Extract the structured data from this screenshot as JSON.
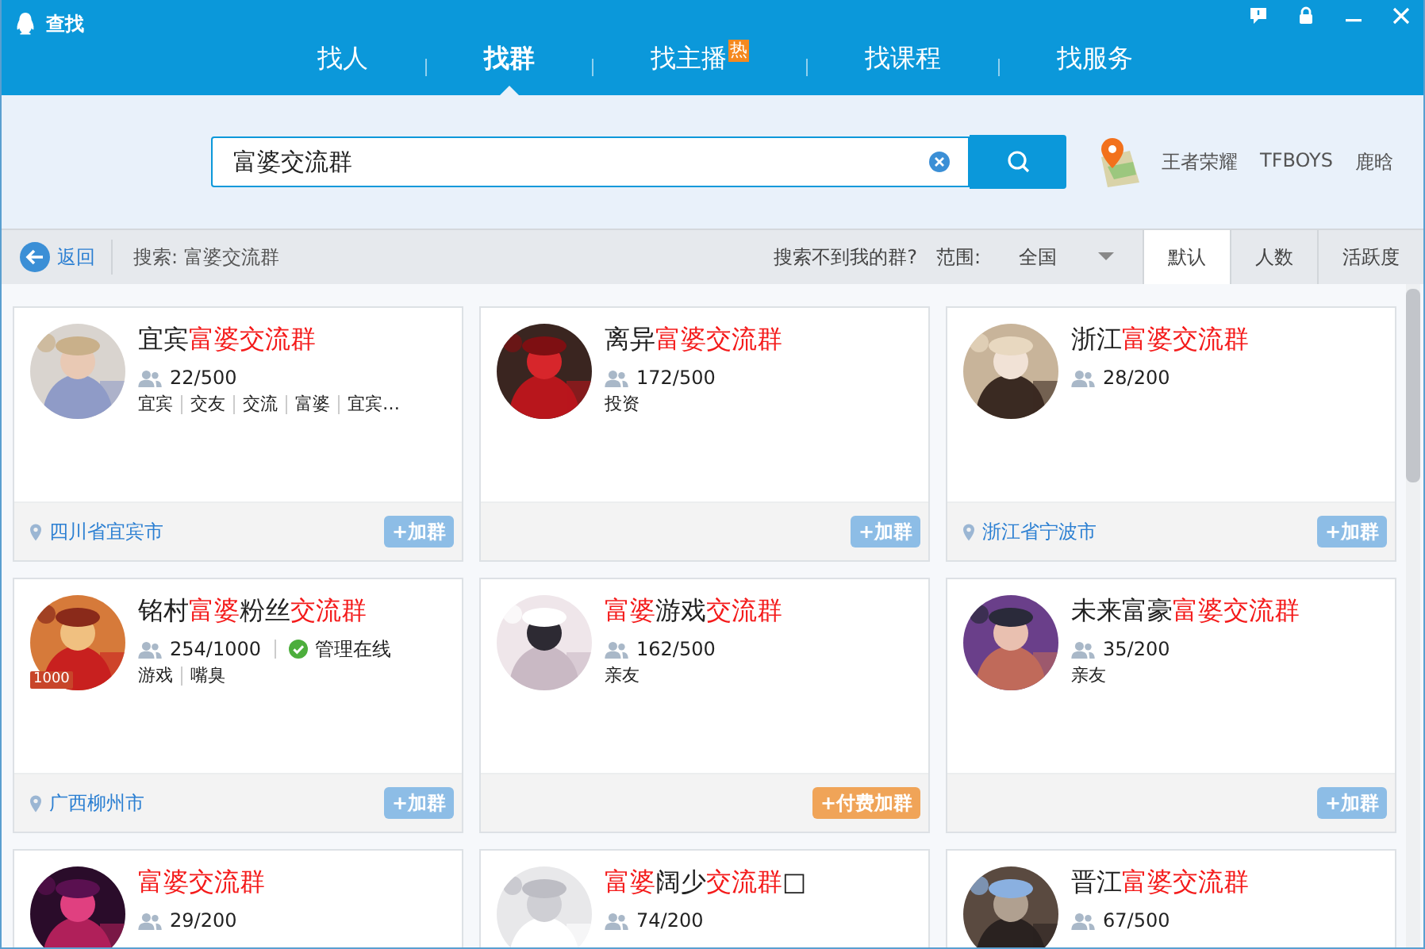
{
  "window": {
    "title": "查找"
  },
  "nav": [
    {
      "label": "找人",
      "selected": false
    },
    {
      "label": "找群",
      "selected": true
    },
    {
      "label": "找主播",
      "selected": false,
      "badge": "热"
    },
    {
      "label": "找课程",
      "selected": false
    },
    {
      "label": "找服务",
      "selected": false
    }
  ],
  "search": {
    "value": "富婆交流群"
  },
  "hot_words": [
    "王者荣耀",
    "TFBOYS",
    "鹿晗"
  ],
  "toolbar": {
    "back": "返回",
    "query": "搜索: 富婆交流群",
    "help_link": "搜索不到我的群?",
    "scope_label": "范围:",
    "scope": "全国",
    "sort_tabs": [
      {
        "label": "默认",
        "selected": true
      },
      {
        "label": "人数",
        "selected": false
      },
      {
        "label": "活跃度",
        "selected": false
      }
    ]
  },
  "cards": [
    {
      "title": [
        {
          "text": "宜宾",
          "highlight": false
        },
        {
          "text": "富婆交流群",
          "highlight": true
        }
      ],
      "members": "22/500",
      "tags": [
        "宜宾",
        "交友",
        "交流",
        "富婆",
        "宜宾…"
      ],
      "location": "四川省宜宾市",
      "join": {
        "kind": "free",
        "label": "+加群"
      }
    },
    {
      "title": [
        {
          "text": "离异",
          "highlight": false
        },
        {
          "text": "富婆交流群",
          "highlight": true
        }
      ],
      "members": "172/500",
      "tags": [
        "投资"
      ],
      "join": {
        "kind": "free",
        "label": "+加群"
      }
    },
    {
      "title": [
        {
          "text": "浙江",
          "highlight": false
        },
        {
          "text": "富婆交流群",
          "highlight": true
        }
      ],
      "members": "28/200",
      "location": "浙江省宁波市",
      "join": {
        "kind": "free",
        "label": "+加群"
      }
    },
    {
      "title": [
        {
          "text": "铭村",
          "highlight": false
        },
        {
          "text": "富婆",
          "highlight": true
        },
        {
          "text": "粉丝",
          "highlight": false
        },
        {
          "text": "交流群",
          "highlight": true
        }
      ],
      "avatar_badge": "1000",
      "members": "254/1000",
      "status": "管理在线",
      "tags": [
        "游戏",
        "嘴臭"
      ],
      "location": "广西柳州市",
      "join": {
        "kind": "free",
        "label": "+加群"
      }
    },
    {
      "title": [
        {
          "text": "富婆",
          "highlight": true
        },
        {
          "text": "游戏",
          "highlight": false
        },
        {
          "text": "交流群",
          "highlight": true
        }
      ],
      "members": "162/500",
      "tags": [
        "亲友"
      ],
      "join": {
        "kind": "paid",
        "label": "+付费加群"
      }
    },
    {
      "title": [
        {
          "text": "未来富豪",
          "highlight": false
        },
        {
          "text": "富婆交流群",
          "highlight": true
        }
      ],
      "members": "35/200",
      "tags": [
        "亲友"
      ],
      "join": {
        "kind": "free",
        "label": "+加群"
      }
    },
    {
      "title": [
        {
          "text": "富婆交流群",
          "highlight": true
        }
      ],
      "members": "29/200"
    },
    {
      "title": [
        {
          "text": "富婆",
          "highlight": true
        },
        {
          "text": "阔少",
          "highlight": false
        },
        {
          "text": "交流群",
          "highlight": true
        },
        {
          "text": "□",
          "highlight": false
        }
      ],
      "members": "74/200"
    },
    {
      "title": [
        {
          "text": "晋江",
          "highlight": false
        },
        {
          "text": "富婆交流群",
          "highlight": true
        }
      ],
      "members": "67/500"
    }
  ]
}
